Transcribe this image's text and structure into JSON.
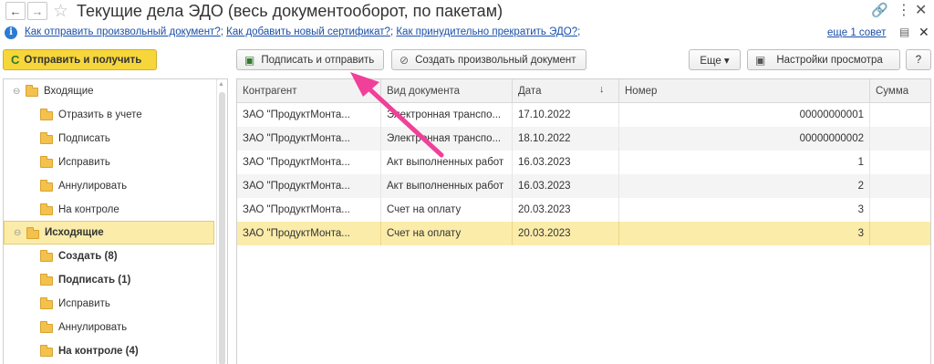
{
  "window": {
    "title": "Текущие дела ЭДО (весь документооборот, по пакетам)",
    "back_icon": "←",
    "forward_icon": "→",
    "star_icon": "☆",
    "link_icon": "🔗",
    "more_icon": "⋮",
    "close_icon": "✕"
  },
  "infobar": {
    "info_icon": "i",
    "links": [
      "Как отправить произвольный документ?",
      "Как добавить новый сертификат?",
      "Как принудительно прекратить ЭДО?"
    ],
    "separator": ";",
    "trailing": ";",
    "advice": "еще 1 совет",
    "doc_icon": "▤",
    "close_icon": "✕"
  },
  "toolbar": {
    "send_receive": "Отправить и получить",
    "send_receive_icon": "C",
    "sign_send": "Подписать и отправить",
    "sign_send_icon": "▣",
    "create_doc": "Создать произвольный документ",
    "create_doc_icon": "⊘",
    "more": "Еще ▾",
    "view_settings": "Настройки просмотра",
    "view_settings_icon": "▣",
    "help": "?"
  },
  "tree": {
    "items": [
      {
        "label": "Входящие",
        "level": 0,
        "expander": "⊖",
        "bold": false,
        "selected": false
      },
      {
        "label": "Отразить в учете",
        "level": 1,
        "bold": false,
        "selected": false
      },
      {
        "label": "Подписать",
        "level": 1,
        "bold": false,
        "selected": false
      },
      {
        "label": "Исправить",
        "level": 1,
        "bold": false,
        "selected": false
      },
      {
        "label": "Аннулировать",
        "level": 1,
        "bold": false,
        "selected": false
      },
      {
        "label": "На контроле",
        "level": 1,
        "bold": false,
        "selected": false
      },
      {
        "label": "Исходящие",
        "level": 0,
        "expander": "⊖",
        "bold": true,
        "selected": true
      },
      {
        "label": "Создать (8)",
        "level": 1,
        "bold": true,
        "selected": false
      },
      {
        "label": "Подписать (1)",
        "level": 1,
        "bold": true,
        "selected": false
      },
      {
        "label": "Исправить",
        "level": 1,
        "bold": false,
        "selected": false
      },
      {
        "label": "Аннулировать",
        "level": 1,
        "bold": false,
        "selected": false
      },
      {
        "label": "На контроле (4)",
        "level": 1,
        "bold": true,
        "selected": false
      }
    ]
  },
  "table": {
    "columns": [
      "Контрагент",
      "Вид документа",
      "Дата",
      "Номер",
      "Сумма"
    ],
    "sort_icon": "↓",
    "rows": [
      {
        "counterparty": "ЗАО \"ПродуктМонта...",
        "doc_type": "Электронная транспо...",
        "date": "17.10.2022",
        "number": "00000000001",
        "sum": ""
      },
      {
        "counterparty": "ЗАО \"ПродуктМонта...",
        "doc_type": "Электронная транспо...",
        "date": "18.10.2022",
        "number": "00000000002",
        "sum": ""
      },
      {
        "counterparty": "ЗАО \"ПродуктМонта...",
        "doc_type": "Акт выполненных работ",
        "date": "16.03.2023",
        "number": "1",
        "sum": ""
      },
      {
        "counterparty": "ЗАО \"ПродуктМонта...",
        "doc_type": "Акт выполненных работ",
        "date": "16.03.2023",
        "number": "2",
        "sum": ""
      },
      {
        "counterparty": "ЗАО \"ПродуктМонта...",
        "doc_type": "Счет на оплату",
        "date": "20.03.2023",
        "number": "3",
        "sum": ""
      },
      {
        "counterparty": "ЗАО \"ПродуктМонта...",
        "doc_type": "Счет на оплату",
        "date": "20.03.2023",
        "number": "3",
        "sum": ""
      }
    ],
    "selected_row": 5
  },
  "colors": {
    "accent_yellow": "#f6d63b",
    "selection": "#fcecaa",
    "link": "#1a4fa8",
    "arrow": "#f0409a"
  }
}
